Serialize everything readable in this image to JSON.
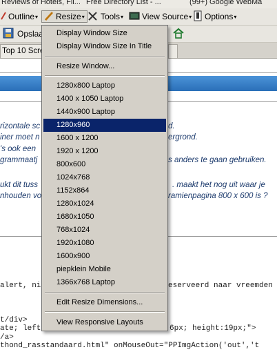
{
  "bookmarks": {
    "items": [
      "Reviews of Hotels, Fli...",
      "Free Directory List - ...",
      "(99+) Google WebMa"
    ]
  },
  "toolbar": {
    "outline_label": "Outline",
    "resize_label": "Resize",
    "tools_label": "Tools",
    "view_source_label": "View Source",
    "options_label": "Options",
    "save_label": "Opslaa"
  },
  "tabs": [
    "Top 10 Scre",
    ""
  ],
  "content": {
    "lines": [
      "rizontale sc",
      "d.",
      "iner moet n",
      "ergrond.",
      "'s ook een",
      "grammaatj",
      "s anders te gaan gebruiken.",
      "ukt dit tuss",
      ". maakt het nog uit waar je",
      "nhouden vo",
      "ramienpagina 800 x 600 is ?"
    ],
    "code": [
      "alert, ni",
      "eserveerd naar vreemden",
      "t/div>",
      "ate; left",
      "6px; height:19px;\">",
      "/a>",
      "thond_rasstandaard.html\" onMouseOut=\"PPImgAction('out','t"
    ]
  },
  "menu": {
    "display_window_size": "Display Window Size",
    "display_window_size_in_title": "Display Window Size In Title",
    "resize_window": "Resize Window...",
    "sizes": [
      "1280x800 Laptop",
      "1400 x 1050 Laptop",
      "1440x900 Laptop",
      "1280x960",
      "1600 x 1200",
      "1920 x 1200",
      "800x600",
      "1024x768",
      "1152x864",
      "1280x1024",
      "1680x1050",
      "768x1024",
      "1920x1080",
      "1600x900",
      "piepklein Mobile",
      "1366x768 Laptop"
    ],
    "selected": "1280x960",
    "edit_resize_dimensions": "Edit Resize Dimensions...",
    "view_responsive_layouts": "View Responsive Layouts"
  }
}
